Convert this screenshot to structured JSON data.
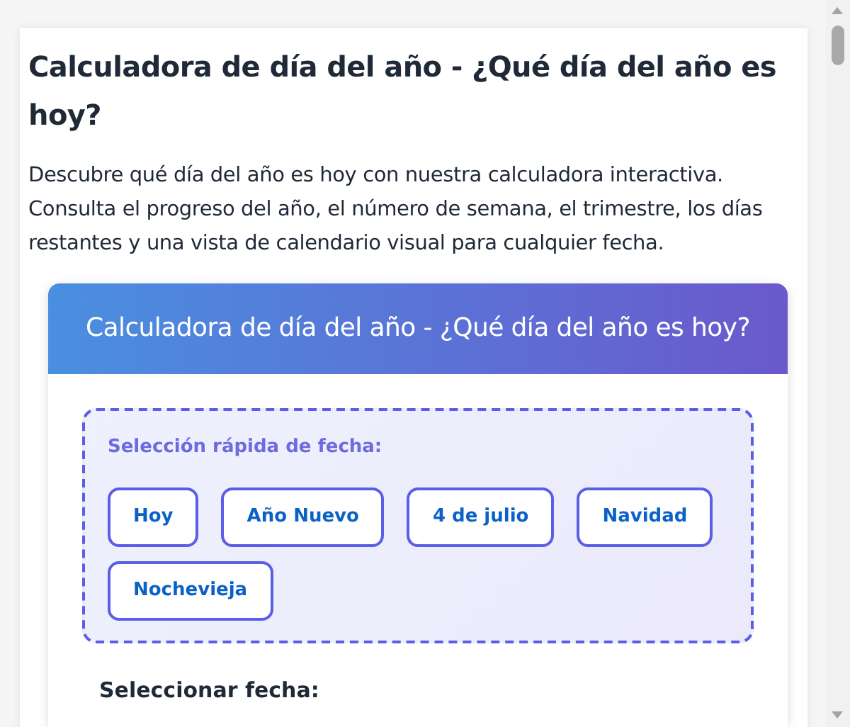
{
  "article": {
    "title": "Calculadora de día del año - ¿Qué día del año es hoy?",
    "intro": "Descubre qué día del año es hoy con nuestra calculadora interactiva. Consulta el progreso del año, el número de semana, el trimestre, los días restantes y una vista de calendario visual para cualquier fecha."
  },
  "calculator": {
    "header": "Calculadora de día del año - ¿Qué día del año es hoy?",
    "quick_select": {
      "label": "Selección rápida de fecha:",
      "buttons": [
        "Hoy",
        "Año Nuevo",
        "4 de julio",
        "Navidad",
        "Nochevieja"
      ]
    },
    "date_label": "Seleccionar fecha:"
  }
}
